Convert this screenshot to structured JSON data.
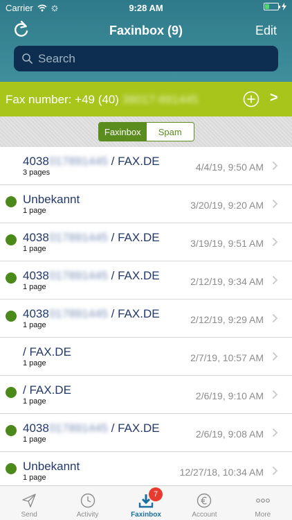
{
  "status": {
    "carrier": "Carrier",
    "time": "9:28 AM"
  },
  "nav": {
    "title": "Faxinbox (9)",
    "edit_label": "Edit"
  },
  "search": {
    "placeholder": "Search"
  },
  "fax": {
    "label": "Fax number: +49 (40) ",
    "number_blurred": "38017-891445"
  },
  "segments": {
    "faxinbox": "Faxinbox",
    "spam": "Spam"
  },
  "items": [
    {
      "prefix": "4038",
      "blurred": "017891445",
      "suffix": " / FAX.DE",
      "pages": "3 pages",
      "date": "4/4/19, 9:50 AM",
      "unread": false
    },
    {
      "prefix": "Unbekannt",
      "blurred": "",
      "suffix": "",
      "pages": "1 page",
      "date": "3/20/19, 9:20 AM",
      "unread": true
    },
    {
      "prefix": "4038",
      "blurred": "017891445",
      "suffix": " / FAX.DE",
      "pages": "1 page",
      "date": "3/19/19, 9:51 AM",
      "unread": true
    },
    {
      "prefix": "4038",
      "blurred": "017891445",
      "suffix": " / FAX.DE",
      "pages": "1 page",
      "date": "2/12/19, 9:34 AM",
      "unread": true
    },
    {
      "prefix": "4038",
      "blurred": "017891445",
      "suffix": " / FAX.DE",
      "pages": "1 page",
      "date": "2/12/19, 9:29 AM",
      "unread": true
    },
    {
      "prefix": "/ FAX.DE",
      "blurred": "",
      "suffix": "",
      "pages": "1 page",
      "date": "2/7/19, 10:57 AM",
      "unread": false
    },
    {
      "prefix": "/ FAX.DE",
      "blurred": "",
      "suffix": "",
      "pages": "1 page",
      "date": "2/6/19, 9:10 AM",
      "unread": true
    },
    {
      "prefix": "4038",
      "blurred": "017891445",
      "suffix": " / FAX.DE",
      "pages": "1 page",
      "date": "2/6/19, 9:08 AM",
      "unread": true
    },
    {
      "prefix": "Unbekannt",
      "blurred": "",
      "suffix": "",
      "pages": "1 page",
      "date": "12/27/18, 10:34 AM",
      "unread": true
    }
  ],
  "tabs": {
    "send": "Send",
    "activity": "Activity",
    "faxinbox": "Faxinbox",
    "faxinbox_badge": "7",
    "account": "Account",
    "more": "More"
  },
  "colors": {
    "header": "#3a8796",
    "fax_bar": "#a8c51c",
    "accent_green": "#5a8c1e",
    "title_blue": "#213869",
    "active_tab": "#1a6fa0",
    "badge": "#e83b30"
  }
}
